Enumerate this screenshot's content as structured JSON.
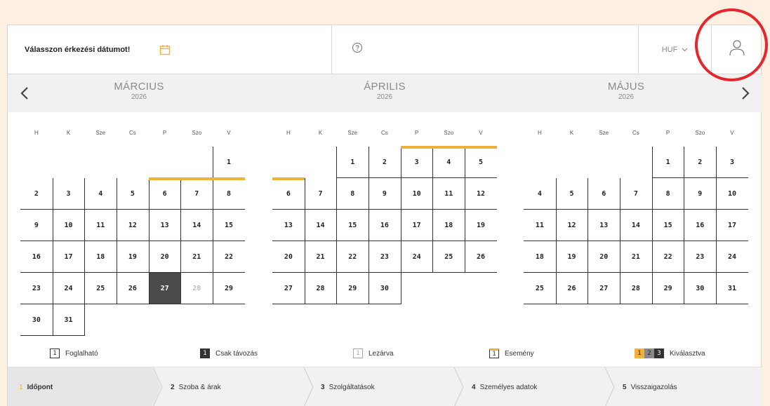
{
  "topbar": {
    "date_prompt": "Válasszon érkezési dátumot!",
    "currency": "HUF"
  },
  "months": [
    {
      "name": "MÁRCIUS",
      "year": "2026",
      "days": [
        [
          "",
          "",
          "",
          "",
          "",
          "",
          "1"
        ],
        [
          "2",
          "3",
          "4",
          "5",
          "6",
          "7",
          "8"
        ],
        [
          "9",
          "10",
          "11",
          "12",
          "13",
          "14",
          "15"
        ],
        [
          "16",
          "17",
          "18",
          "19",
          "20",
          "21",
          "22"
        ],
        [
          "23",
          "24",
          "25",
          "26",
          "27",
          "28",
          "29"
        ],
        [
          "30",
          "31",
          "",
          "",
          "",
          "",
          ""
        ]
      ],
      "selected": [
        "27"
      ],
      "disabled": [
        "28"
      ],
      "event": [
        "6",
        "7",
        "8"
      ]
    },
    {
      "name": "ÁPRILIS",
      "year": "2026",
      "days": [
        [
          "",
          "",
          "1",
          "2",
          "3",
          "4",
          "5"
        ],
        [
          "6",
          "7",
          "8",
          "9",
          "10",
          "11",
          "12"
        ],
        [
          "13",
          "14",
          "15",
          "16",
          "17",
          "18",
          "19"
        ],
        [
          "20",
          "21",
          "22",
          "23",
          "24",
          "25",
          "26"
        ],
        [
          "27",
          "28",
          "29",
          "30",
          "",
          "",
          ""
        ]
      ],
      "selected": [],
      "disabled": [],
      "event": [
        "3",
        "4",
        "5",
        "6"
      ]
    },
    {
      "name": "MÁJUS",
      "year": "2026",
      "days": [
        [
          "",
          "",
          "",
          "",
          "1",
          "2",
          "3"
        ],
        [
          "4",
          "5",
          "6",
          "7",
          "8",
          "9",
          "10"
        ],
        [
          "11",
          "12",
          "13",
          "14",
          "15",
          "16",
          "17"
        ],
        [
          "18",
          "19",
          "20",
          "21",
          "22",
          "23",
          "24"
        ],
        [
          "25",
          "26",
          "27",
          "28",
          "29",
          "30",
          "31"
        ]
      ],
      "selected": [],
      "disabled": [],
      "event": []
    }
  ],
  "weekdays": [
    "H",
    "K",
    "Sze",
    "Cs",
    "P",
    "Szo",
    "V"
  ],
  "legend": {
    "available": {
      "box": "1",
      "label": "Foglalható"
    },
    "checkout_only": {
      "box": "1",
      "label": "Csak távozás"
    },
    "closed": {
      "box": "1",
      "label": "Lezárva"
    },
    "event": {
      "box": "1",
      "label": "Esemény"
    },
    "selected": {
      "boxes": [
        "1",
        "2",
        "3"
      ],
      "label": "Kiválasztva"
    }
  },
  "steps": [
    {
      "num": "1",
      "label": "Időpont"
    },
    {
      "num": "2",
      "label": "Szoba & árak"
    },
    {
      "num": "3",
      "label": "Szolgáltatások"
    },
    {
      "num": "4",
      "label": "Személyes adatok"
    },
    {
      "num": "5",
      "label": "Visszaigazolás"
    }
  ],
  "colors": {
    "accent": "#f0b13b",
    "selected": "#4a4a4a",
    "highlight_circle": "#e5262d",
    "background": "#fdf0e3"
  },
  "icons": [
    "calendar-icon",
    "help-icon",
    "chevron-down-icon",
    "user-icon",
    "chevron-left-icon",
    "chevron-right-icon"
  ]
}
